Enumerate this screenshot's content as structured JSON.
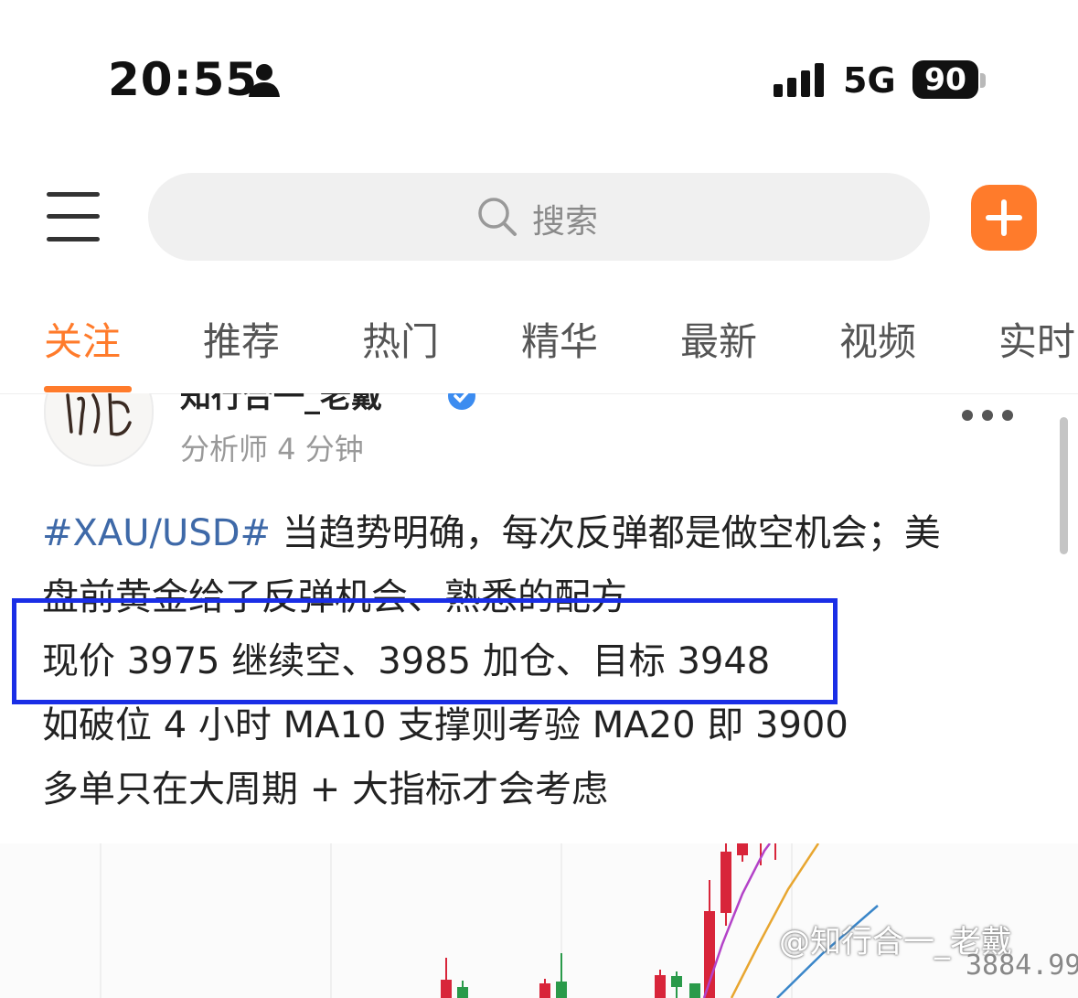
{
  "status_bar": {
    "time": "20:55",
    "network": "5G",
    "battery": "90",
    "icons": [
      "person-icon",
      "signal-icon"
    ]
  },
  "top_bar": {
    "search_placeholder": "搜索",
    "icons": [
      "menu-icon",
      "search-icon",
      "add-icon"
    ],
    "accent_color": "#ff7b2b"
  },
  "tabs": [
    {
      "label": "关注",
      "active": true
    },
    {
      "label": "推荐",
      "active": false
    },
    {
      "label": "热门",
      "active": false
    },
    {
      "label": "精华",
      "active": false
    },
    {
      "label": "最新",
      "active": false
    },
    {
      "label": "视频",
      "active": false
    },
    {
      "label": "实时",
      "active": false
    }
  ],
  "post": {
    "author": "知行合一_老戴",
    "meta": "分析师 4 分钟",
    "hashtag": "#XAU/USD#",
    "lines": [
      "当趋势明确，每次反弹都是做空机会；美",
      "盘前黄金给了反弹机会、熟悉的配方",
      "现价 3975 继续空、3985 加仓、目标 3948",
      "如破位 4 小时 MA10 支撑则考验 MA20 即 3900",
      "多单只在大周期 + 大指标才会考虑"
    ],
    "highlight_color": "#1a2ee6"
  },
  "chart": {
    "watermark": "@知行合一_老戴",
    "price_label": "3884.99",
    "up_color": "#d8253a",
    "down_color": "#2a9a4a",
    "ma_colors": [
      "#b342c8",
      "#e8a630",
      "#3a86c9"
    ]
  }
}
